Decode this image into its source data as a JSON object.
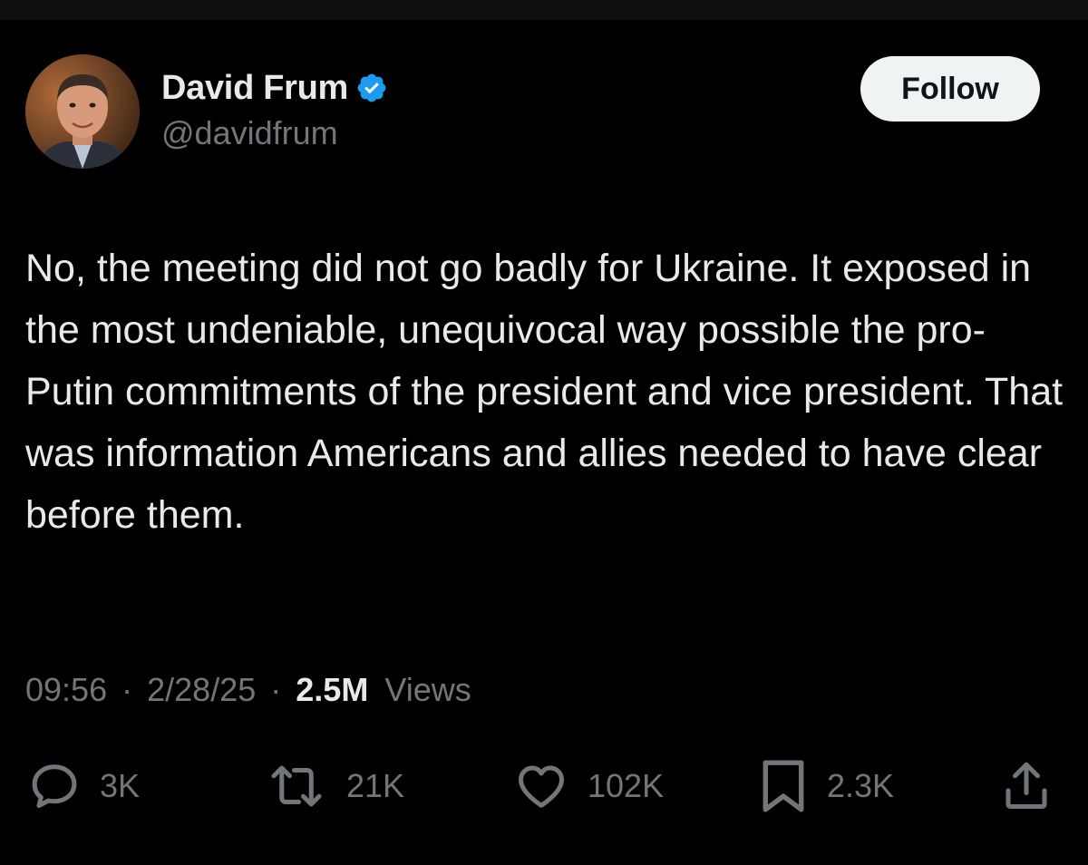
{
  "user": {
    "display_name": "David Frum",
    "handle": "@davidfrum",
    "verified": true,
    "avatar_icon": "person-avatar"
  },
  "follow_button": {
    "label": "Follow"
  },
  "tweet": {
    "text": "No, the meeting did not go badly for Ukraine. It exposed in the most undeniable, unequivocal way possible the pro-Putin commitments of the president and vice president. That was information Americans and allies needed to have clear before them."
  },
  "meta": {
    "time": "09:56",
    "date": "2/28/25",
    "views_count": "2.5M",
    "views_label": "Views",
    "separator": "·"
  },
  "actions": {
    "replies": "3K",
    "reposts": "21K",
    "likes": "102K",
    "bookmarks": "2.3K"
  },
  "icons": {
    "reply": "reply-icon",
    "repost": "repost-icon",
    "like": "heart-icon",
    "bookmark": "bookmark-icon",
    "share": "share-icon",
    "verified": "verified-badge-icon"
  },
  "colors": {
    "background": "#000000",
    "text": "#e7e9ea",
    "muted": "#71767b",
    "verified": "#1d9bf0",
    "button_bg": "#eff3f4"
  }
}
